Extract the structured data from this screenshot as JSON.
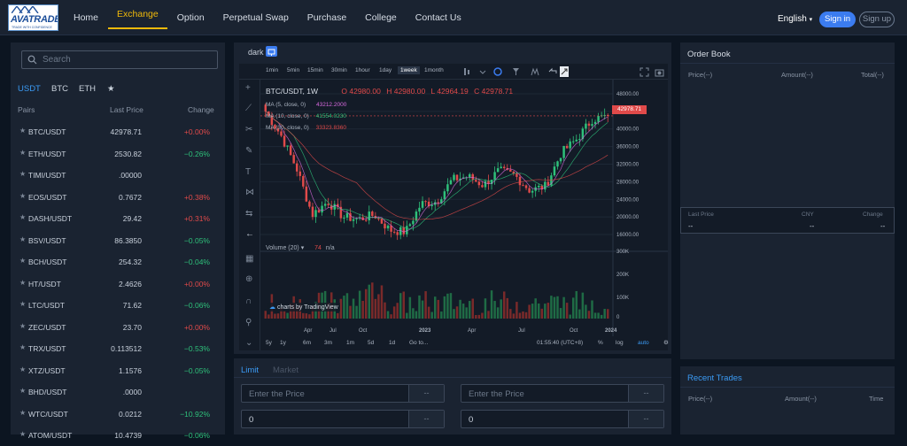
{
  "brand": {
    "name": "AVATRADE",
    "tagline": "TRADE WITH CONFIDENCE"
  },
  "nav": {
    "items": [
      "Home",
      "Exchange",
      "Option",
      "Perpetual Swap",
      "Purchase",
      "College",
      "Contact Us"
    ],
    "active": "Exchange",
    "language": "English",
    "sign_in": "Sign in",
    "sign_up": "Sign up"
  },
  "market": {
    "search_placeholder": "Search",
    "quote_tabs": [
      "USDT",
      "BTC",
      "ETH",
      "★"
    ],
    "headers": {
      "pair": "Pairs",
      "price": "Last Price",
      "change": "Change"
    },
    "rows": [
      {
        "pair": "BTC/USDT",
        "price": "42978.71",
        "change": "+0.00%",
        "dir": "up"
      },
      {
        "pair": "ETH/USDT",
        "price": "2530.82",
        "change": "−0.26%",
        "dir": "down"
      },
      {
        "pair": "TIMI/USDT",
        "price": ".00000",
        "change": "",
        "dir": "flat"
      },
      {
        "pair": "EOS/USDT",
        "price": "0.7672",
        "change": "+0.38%",
        "dir": "up"
      },
      {
        "pair": "DASH/USDT",
        "price": "29.42",
        "change": "+0.31%",
        "dir": "up"
      },
      {
        "pair": "BSV/USDT",
        "price": "86.3850",
        "change": "−0.05%",
        "dir": "down"
      },
      {
        "pair": "BCH/USDT",
        "price": "254.32",
        "change": "−0.04%",
        "dir": "down"
      },
      {
        "pair": "HT/USDT",
        "price": "2.4626",
        "change": "+0.00%",
        "dir": "up"
      },
      {
        "pair": "LTC/USDT",
        "price": "71.62",
        "change": "−0.06%",
        "dir": "down"
      },
      {
        "pair": "ZEC/USDT",
        "price": "23.70",
        "change": "+0.00%",
        "dir": "up"
      },
      {
        "pair": "TRX/USDT",
        "price": "0.113512",
        "change": "−0.53%",
        "dir": "down"
      },
      {
        "pair": "XTZ/USDT",
        "price": "1.1576",
        "change": "−0.05%",
        "dir": "down"
      },
      {
        "pair": "BHD/USDT",
        "price": ".0000",
        "change": "",
        "dir": "flat"
      },
      {
        "pair": "WTC/USDT",
        "price": "0.0212",
        "change": "−10.92%",
        "dir": "down"
      },
      {
        "pair": "ATOM/USDT",
        "price": "10.4739",
        "change": "−0.06%",
        "dir": "down"
      }
    ]
  },
  "chart": {
    "theme_label": "dark",
    "timeframes": [
      "1min",
      "5min",
      "15min",
      "30min",
      "1hour",
      "1day",
      "1week",
      "1month"
    ],
    "active_timeframe": "1week",
    "symbol": "BTC/USDT, 1W",
    "ohlc": {
      "o": "O 42980.00",
      "h": "H 42980.00",
      "l": "L 42964.19",
      "c": "C 42978.71"
    },
    "ma": [
      {
        "label": "MA (5, close, 0)",
        "value": "43212.2000",
        "color": "#d86adf"
      },
      {
        "label": "MA (10, close, 0)",
        "value": "41554.0230",
        "color": "#2ec07a"
      },
      {
        "label": "MA (30, close, 0)",
        "value": "33323.8360",
        "color": "#e04a4a"
      }
    ],
    "volume_label": "Volume (20)",
    "volume_value": "74",
    "volume_na": "n/a",
    "watermark": "charts by TradingView",
    "current_price": "42978.71",
    "price_ticks": [
      "48000.00",
      "44000.00",
      "40000.00",
      "36000.00",
      "32000.00",
      "28000.00",
      "24000.00",
      "20000.00",
      "16000.00"
    ],
    "vol_ticks": [
      "300K",
      "200K",
      "100K",
      "0"
    ],
    "time_ticks": [
      "Apr",
      "Jul",
      "Oct",
      "2023",
      "Apr",
      "Jul",
      "Oct",
      "2024"
    ],
    "ranges": [
      "5y",
      "1y",
      "6m",
      "3m",
      "1m",
      "5d",
      "1d",
      "Go to..."
    ],
    "clock": "01:55:40 (UTC+8)",
    "options": [
      "%",
      "log",
      "auto"
    ]
  },
  "chart_data": {
    "type": "candlestick",
    "x": [
      "2022-03",
      "2022-04",
      "2022-05",
      "2022-06",
      "2022-07",
      "2022-08",
      "2022-09",
      "2022-10",
      "2022-11",
      "2022-12",
      "2023-01",
      "2023-02",
      "2023-03",
      "2023-04",
      "2023-05",
      "2023-06",
      "2023-07",
      "2023-08",
      "2023-09",
      "2023-10",
      "2023-11",
      "2023-12",
      "2024-01"
    ],
    "close": [
      44000,
      38500,
      31000,
      20500,
      23500,
      20000,
      19500,
      20500,
      17000,
      16600,
      23000,
      23500,
      28500,
      29200,
      27200,
      30500,
      29500,
      26000,
      27000,
      34500,
      37700,
      42200,
      42978.71
    ],
    "ylim": [
      14000,
      50000
    ]
  },
  "trade": {
    "tabs": [
      "Limit",
      "Market"
    ],
    "active_tab": "Limit",
    "price_placeholder": "Enter the Price",
    "button": "--",
    "qty": "0"
  },
  "orderbook": {
    "title": "Order Book",
    "headers": [
      "Price(--)",
      "Amount(--)",
      "Total(--)"
    ],
    "last_headers": [
      "Last Price",
      "CNY",
      "Change"
    ],
    "last_values": [
      "--",
      "--",
      "--"
    ]
  },
  "recent": {
    "title": "Recent Trades",
    "headers": [
      "Price(--)",
      "Amount(--)",
      "Time"
    ]
  }
}
